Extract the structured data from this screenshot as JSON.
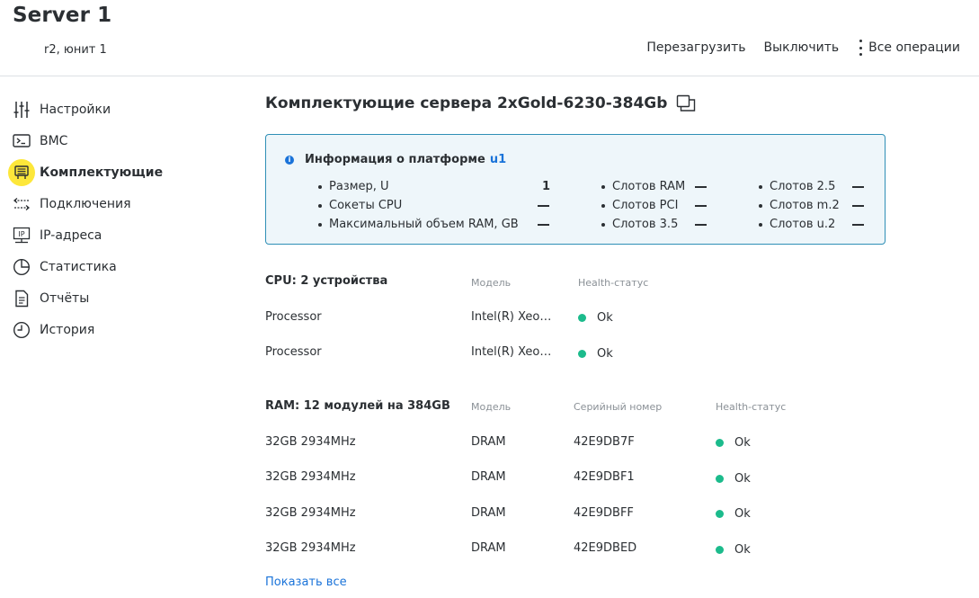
{
  "header": {
    "title": "Server 1",
    "subtitle": "r2, юнит 1",
    "actions": {
      "reboot": "Перезагрузить",
      "shutdown": "Выключить",
      "all_ops": "Все операции"
    }
  },
  "sidebar": {
    "items": [
      {
        "label": "Настройки",
        "icon": "settings-sliders-icon"
      },
      {
        "label": "BMC",
        "icon": "terminal-icon"
      },
      {
        "label": "Комплектующие",
        "icon": "components-icon",
        "active": true
      },
      {
        "label": "Подключения",
        "icon": "connections-icon"
      },
      {
        "label": "IP-адреса",
        "icon": "ip-icon"
      },
      {
        "label": "Статистика",
        "icon": "pie-chart-icon"
      },
      {
        "label": "Отчёты",
        "icon": "report-icon"
      },
      {
        "label": "История",
        "icon": "clock-icon"
      }
    ]
  },
  "main": {
    "title": "Комплектующие сервера 2xGold-6230-384Gb",
    "platform": {
      "heading": "Информация о платформе",
      "link": "u1",
      "specs": [
        {
          "label": "Размер, U",
          "value": "1"
        },
        {
          "label": "Сокеты CPU",
          "value": ""
        },
        {
          "label": "Максимальный объем RAM, GB",
          "value": ""
        },
        {
          "label": "Слотов RAM",
          "value": ""
        },
        {
          "label": "Слотов PCI",
          "value": ""
        },
        {
          "label": "Слотов 3.5",
          "value": ""
        },
        {
          "label": "Слотов 2.5",
          "value": ""
        },
        {
          "label": "Слотов m.2",
          "value": ""
        },
        {
          "label": "Слотов u.2",
          "value": ""
        }
      ]
    },
    "cpu": {
      "title": "CPU: 2 устройства",
      "columns": {
        "model": "Модель",
        "health": "Health-статус"
      },
      "rows": [
        {
          "name": "Processor",
          "model": "Intel(R) Xeo…",
          "health": "Ok"
        },
        {
          "name": "Processor",
          "model": "Intel(R) Xeo…",
          "health": "Ok"
        }
      ]
    },
    "ram": {
      "title": "RAM: 12 модулей на 384GB",
      "columns": {
        "model": "Модель",
        "serial": "Серийный номер",
        "health": "Health-статус"
      },
      "rows": [
        {
          "name": "32GB 2934MHz",
          "model": "DRAM",
          "serial": "42E9DB7F",
          "health": "Ok"
        },
        {
          "name": "32GB 2934MHz",
          "model": "DRAM",
          "serial": "42E9DBF1",
          "health": "Ok"
        },
        {
          "name": "32GB 2934MHz",
          "model": "DRAM",
          "serial": "42E9DBFF",
          "health": "Ok"
        },
        {
          "name": "32GB 2934MHz",
          "model": "DRAM",
          "serial": "42E9DBED",
          "health": "Ok"
        }
      ],
      "show_all": "Показать все"
    }
  },
  "colors": {
    "accent": "#1a73d9",
    "active_nav": "#fde73a",
    "status_ok": "#1cbb8c",
    "info_border": "#2f8fb6"
  }
}
